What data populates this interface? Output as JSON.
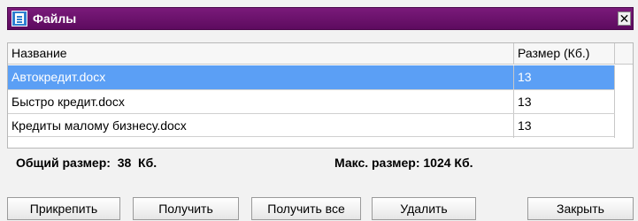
{
  "window": {
    "title": "Файлы",
    "icon": "file-list-icon",
    "close_label": "✕"
  },
  "table": {
    "columns": [
      "Название",
      "Размер (Кб.)"
    ],
    "rows": [
      {
        "name": "Автокредит.docx",
        "size": "13",
        "selected": true
      },
      {
        "name": "Быстро кредит.docx",
        "size": "13",
        "selected": false
      },
      {
        "name": "Кредиты малому бизнесу.docx",
        "size": "13",
        "selected": false
      }
    ]
  },
  "summary": {
    "total": "Общий размер:  38  Кб.",
    "max": "Макс. размер: 1024 Кб."
  },
  "buttons": {
    "attach": "Прикрепить",
    "get": "Получить",
    "get_all": "Получить все",
    "delete": "Удалить",
    "close": "Закрыть"
  },
  "colors": {
    "titlebar": "#5d0b5f",
    "selection": "#5b9ff5"
  }
}
